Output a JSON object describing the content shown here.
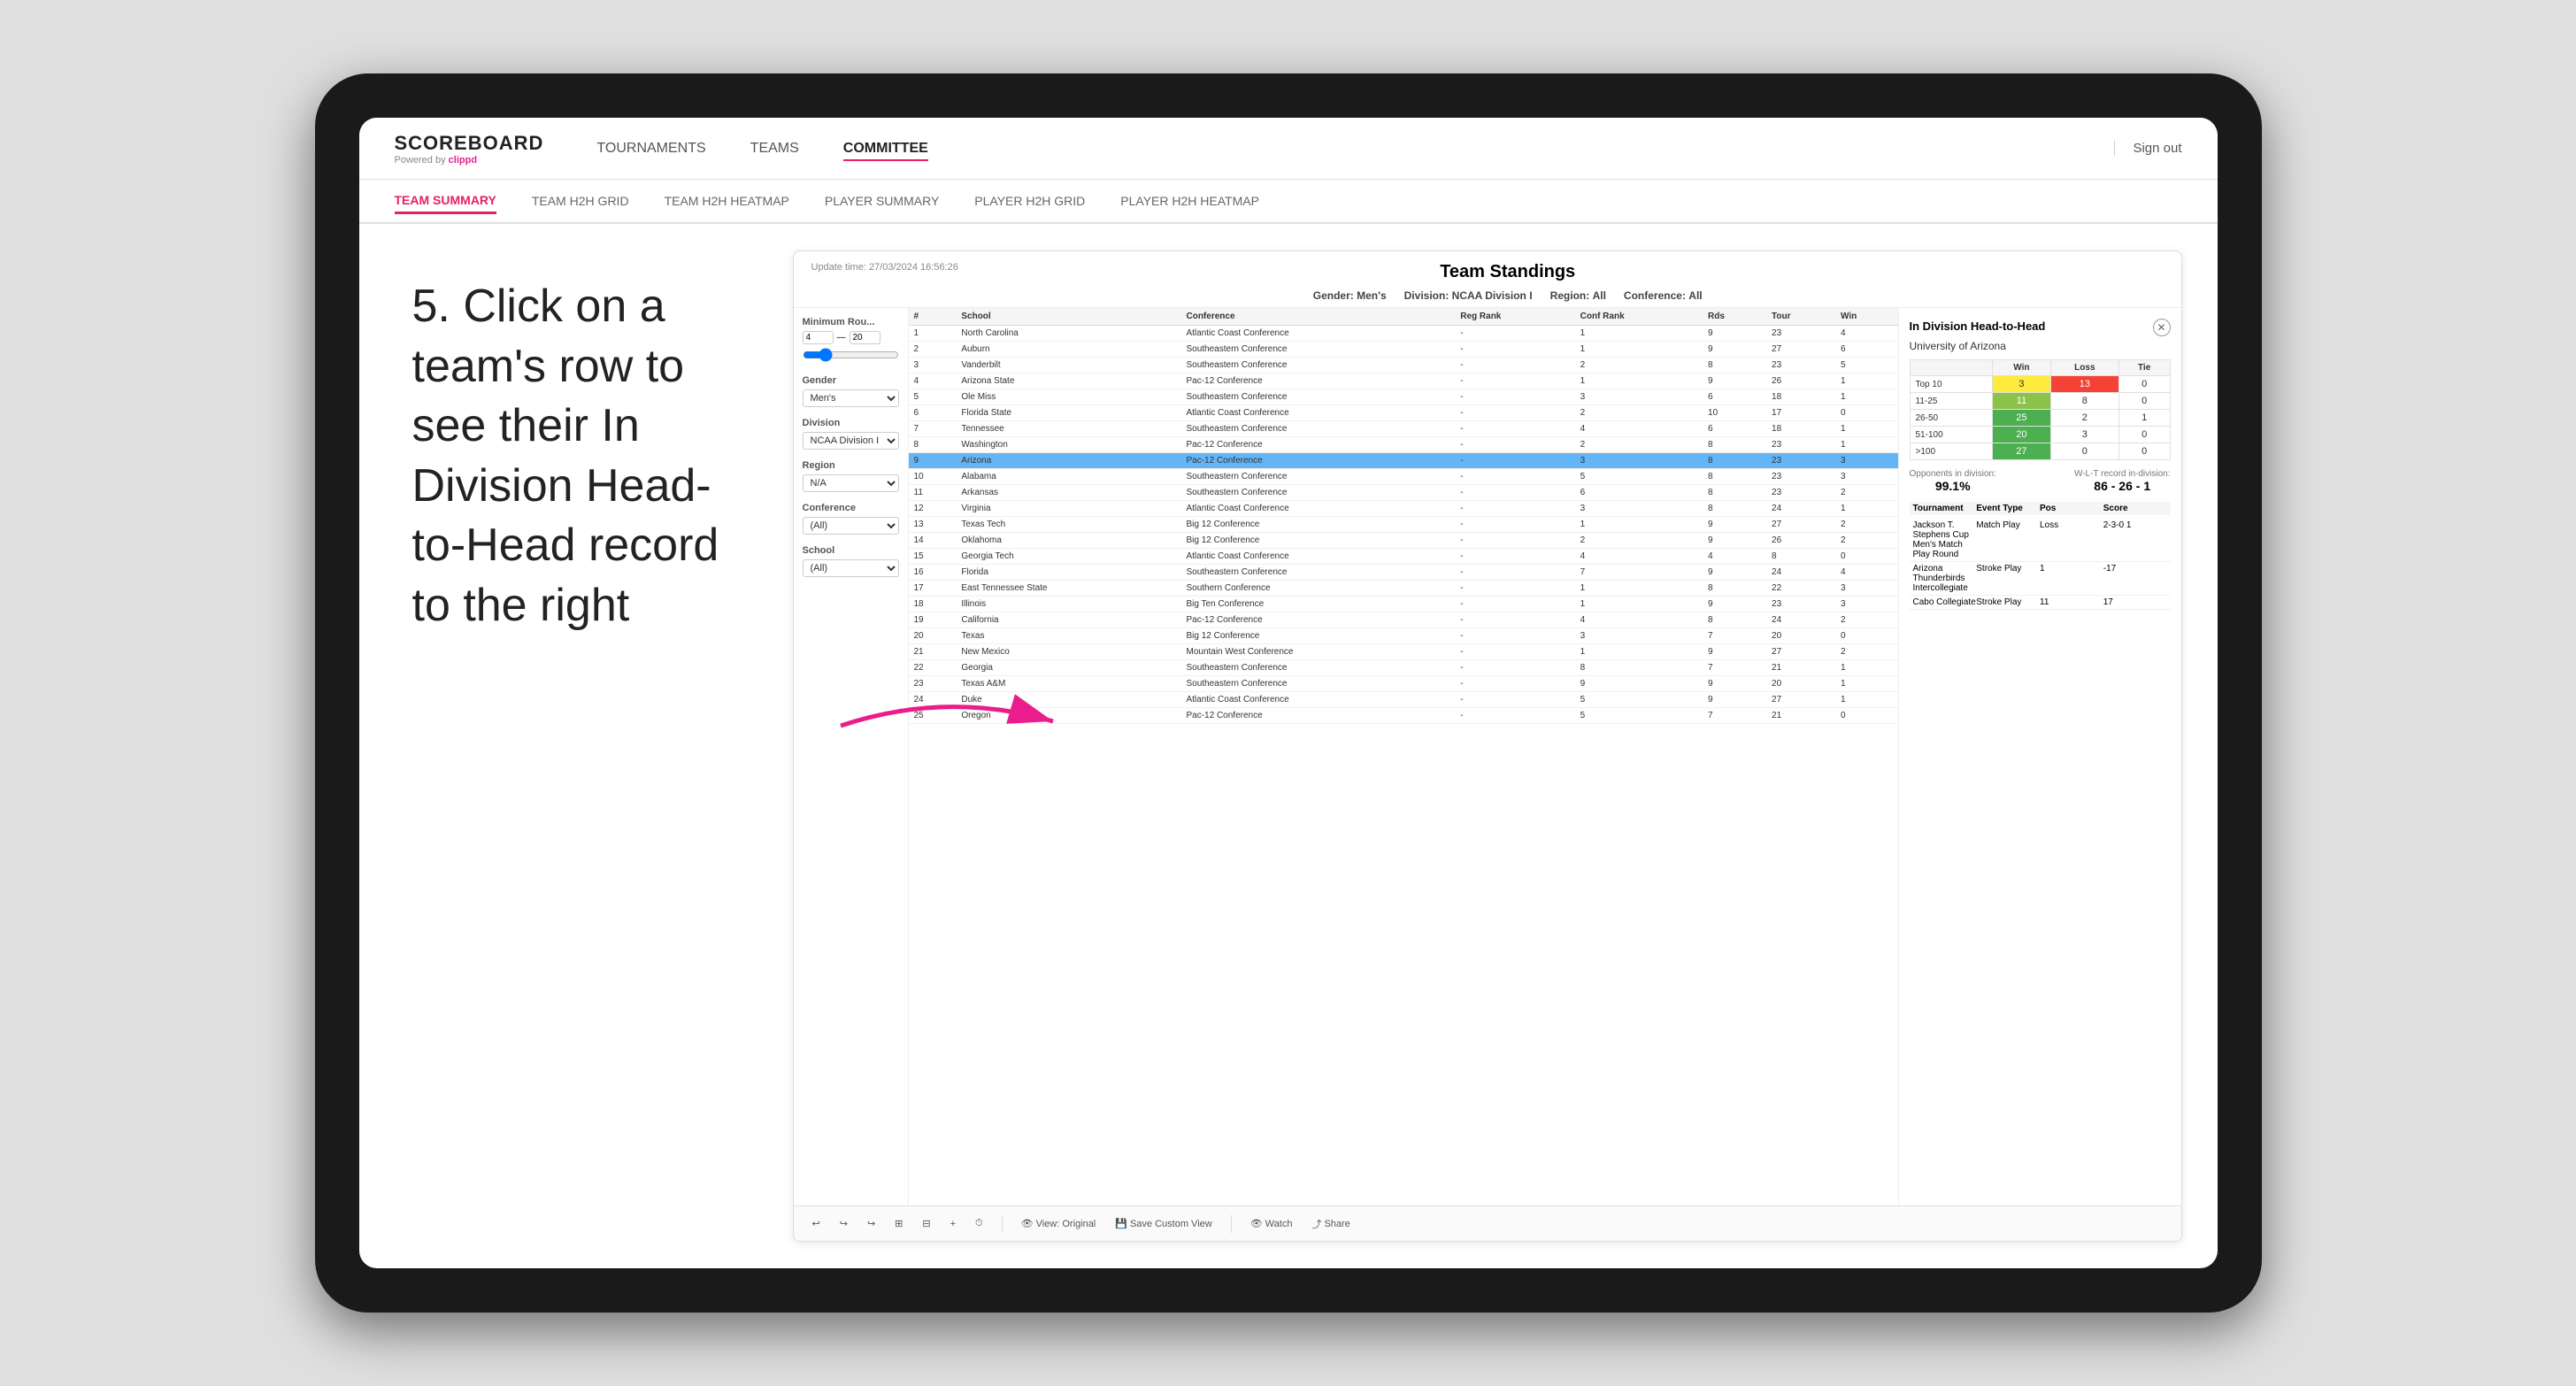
{
  "app": {
    "logo": "SCOREBOARD",
    "logo_sub": "Powered by ",
    "logo_brand": "clippd",
    "nav_links": [
      "TOURNAMENTS",
      "TEAMS",
      "COMMITTEE"
    ],
    "active_nav": "COMMITTEE",
    "sign_out": "Sign out",
    "sub_nav": [
      "TEAM SUMMARY",
      "TEAM H2H GRID",
      "TEAM H2H HEATMAP",
      "PLAYER SUMMARY",
      "PLAYER H2H GRID",
      "PLAYER H2H HEATMAP"
    ],
    "active_sub": "TEAM SUMMARY"
  },
  "instruction": {
    "text": "5. Click on a team's row to see their In Division Head-to-Head record to the right"
  },
  "standings": {
    "update_time_label": "Update time:",
    "update_time": "27/03/2024 16:56:26",
    "title": "Team Standings",
    "gender_label": "Gender:",
    "gender": "Men's",
    "division_label": "Division:",
    "division": "NCAA Division I",
    "region_label": "Region:",
    "region": "All",
    "conference_label": "Conference:",
    "conference": "All"
  },
  "filters": {
    "min_rounds_label": "Minimum Rou...",
    "min_rounds_value": "4",
    "min_rounds_max": "20",
    "gender_label": "Gender",
    "gender_value": "Men's",
    "division_label": "Division",
    "division_value": "NCAA Division I",
    "region_label": "Region",
    "region_value": "N/A",
    "conference_label": "Conference",
    "conference_value": "(All)",
    "school_label": "School",
    "school_value": "(All)"
  },
  "table": {
    "headers": [
      "#",
      "School",
      "Conference",
      "Reg Rank",
      "Conf Rank",
      "Rds",
      "Tour",
      "Win"
    ],
    "rows": [
      {
        "num": "1",
        "school": "North Carolina",
        "conference": "Atlantic Coast Conference",
        "reg_rank": "-",
        "conf_rank": "1",
        "rds": "9",
        "tour": "23",
        "win": "4"
      },
      {
        "num": "2",
        "school": "Auburn",
        "conference": "Southeastern Conference",
        "reg_rank": "-",
        "conf_rank": "1",
        "rds": "9",
        "tour": "27",
        "win": "6"
      },
      {
        "num": "3",
        "school": "Vanderbilt",
        "conference": "Southeastern Conference",
        "reg_rank": "-",
        "conf_rank": "2",
        "rds": "8",
        "tour": "23",
        "win": "5"
      },
      {
        "num": "4",
        "school": "Arizona State",
        "conference": "Pac-12 Conference",
        "reg_rank": "-",
        "conf_rank": "1",
        "rds": "9",
        "tour": "26",
        "win": "1"
      },
      {
        "num": "5",
        "school": "Ole Miss",
        "conference": "Southeastern Conference",
        "reg_rank": "-",
        "conf_rank": "3",
        "rds": "6",
        "tour": "18",
        "win": "1"
      },
      {
        "num": "6",
        "school": "Florida State",
        "conference": "Atlantic Coast Conference",
        "reg_rank": "-",
        "conf_rank": "2",
        "rds": "10",
        "tour": "17",
        "win": "0"
      },
      {
        "num": "7",
        "school": "Tennessee",
        "conference": "Southeastern Conference",
        "reg_rank": "-",
        "conf_rank": "4",
        "rds": "6",
        "tour": "18",
        "win": "1"
      },
      {
        "num": "8",
        "school": "Washington",
        "conference": "Pac-12 Conference",
        "reg_rank": "-",
        "conf_rank": "2",
        "rds": "8",
        "tour": "23",
        "win": "1"
      },
      {
        "num": "9",
        "school": "Arizona",
        "conference": "Pac-12 Conference",
        "reg_rank": "-",
        "conf_rank": "3",
        "rds": "8",
        "tour": "23",
        "win": "3",
        "selected": true
      },
      {
        "num": "10",
        "school": "Alabama",
        "conference": "Southeastern Conference",
        "reg_rank": "-",
        "conf_rank": "5",
        "rds": "8",
        "tour": "23",
        "win": "3"
      },
      {
        "num": "11",
        "school": "Arkansas",
        "conference": "Southeastern Conference",
        "reg_rank": "-",
        "conf_rank": "6",
        "rds": "8",
        "tour": "23",
        "win": "2"
      },
      {
        "num": "12",
        "school": "Virginia",
        "conference": "Atlantic Coast Conference",
        "reg_rank": "-",
        "conf_rank": "3",
        "rds": "8",
        "tour": "24",
        "win": "1"
      },
      {
        "num": "13",
        "school": "Texas Tech",
        "conference": "Big 12 Conference",
        "reg_rank": "-",
        "conf_rank": "1",
        "rds": "9",
        "tour": "27",
        "win": "2"
      },
      {
        "num": "14",
        "school": "Oklahoma",
        "conference": "Big 12 Conference",
        "reg_rank": "-",
        "conf_rank": "2",
        "rds": "9",
        "tour": "26",
        "win": "2"
      },
      {
        "num": "15",
        "school": "Georgia Tech",
        "conference": "Atlantic Coast Conference",
        "reg_rank": "-",
        "conf_rank": "4",
        "rds": "4",
        "tour": "8",
        "win": "0"
      },
      {
        "num": "16",
        "school": "Florida",
        "conference": "Southeastern Conference",
        "reg_rank": "-",
        "conf_rank": "7",
        "rds": "9",
        "tour": "24",
        "win": "4"
      },
      {
        "num": "17",
        "school": "East Tennessee State",
        "conference": "Southern Conference",
        "reg_rank": "-",
        "conf_rank": "1",
        "rds": "8",
        "tour": "22",
        "win": "3"
      },
      {
        "num": "18",
        "school": "Illinois",
        "conference": "Big Ten Conference",
        "reg_rank": "-",
        "conf_rank": "1",
        "rds": "9",
        "tour": "23",
        "win": "3"
      },
      {
        "num": "19",
        "school": "California",
        "conference": "Pac-12 Conference",
        "reg_rank": "-",
        "conf_rank": "4",
        "rds": "8",
        "tour": "24",
        "win": "2"
      },
      {
        "num": "20",
        "school": "Texas",
        "conference": "Big 12 Conference",
        "reg_rank": "-",
        "conf_rank": "3",
        "rds": "7",
        "tour": "20",
        "win": "0"
      },
      {
        "num": "21",
        "school": "New Mexico",
        "conference": "Mountain West Conference",
        "reg_rank": "-",
        "conf_rank": "1",
        "rds": "9",
        "tour": "27",
        "win": "2"
      },
      {
        "num": "22",
        "school": "Georgia",
        "conference": "Southeastern Conference",
        "reg_rank": "-",
        "conf_rank": "8",
        "rds": "7",
        "tour": "21",
        "win": "1"
      },
      {
        "num": "23",
        "school": "Texas A&M",
        "conference": "Southeastern Conference",
        "reg_rank": "-",
        "conf_rank": "9",
        "rds": "9",
        "tour": "20",
        "win": "1"
      },
      {
        "num": "24",
        "school": "Duke",
        "conference": "Atlantic Coast Conference",
        "reg_rank": "-",
        "conf_rank": "5",
        "rds": "9",
        "tour": "27",
        "win": "1"
      },
      {
        "num": "25",
        "school": "Oregon",
        "conference": "Pac-12 Conference",
        "reg_rank": "-",
        "conf_rank": "5",
        "rds": "7",
        "tour": "21",
        "win": "0"
      }
    ]
  },
  "h2h": {
    "title": "In Division Head-to-Head",
    "school": "University of Arizona",
    "win_label": "Win",
    "loss_label": "Loss",
    "tie_label": "Tie",
    "rows": [
      {
        "label": "Top 10",
        "win": "3",
        "loss": "13",
        "tie": "0",
        "win_class": "cell-yellow",
        "loss_class": "cell-red"
      },
      {
        "label": "11-25",
        "win": "11",
        "loss": "8",
        "tie": "0",
        "win_class": "cell-light-green",
        "loss_class": ""
      },
      {
        "label": "26-50",
        "win": "25",
        "loss": "2",
        "tie": "1",
        "win_class": "cell-green",
        "loss_class": ""
      },
      {
        "label": "51-100",
        "win": "20",
        "loss": "3",
        "tie": "0",
        "win_class": "cell-green",
        "loss_class": ""
      },
      {
        "label": ">100",
        "win": "27",
        "loss": "0",
        "tie": "0",
        "win_class": "cell-green",
        "loss_class": ""
      }
    ],
    "opponents_label": "Opponents in division:",
    "opponents_value": "99.1%",
    "wlt_label": "W-L-T record in-division:",
    "wlt_value": "86 - 26 - 1",
    "tournament_label": "Tournament",
    "event_type_label": "Event Type",
    "pos_label": "Pos",
    "score_label": "Score",
    "tournaments": [
      {
        "name": "Jackson T. Stephens Cup Men's Match Play Round",
        "event_type": "Match Play",
        "pos": "Loss",
        "score": "2-3-0 1"
      },
      {
        "name": "Arizona Thunderbirds Intercollegiate",
        "event_type": "Stroke Play",
        "pos": "1",
        "score": "-17"
      },
      {
        "name": "Cabo Collegiate",
        "event_type": "Stroke Play",
        "pos": "11",
        "score": "17"
      }
    ]
  },
  "toolbar": {
    "undo": "↩",
    "redo_1": "↪",
    "redo_2": "↪",
    "copy": "⊞",
    "paste": "⊟",
    "clock": "⏱",
    "view_original": "View: Original",
    "save_custom": "Save Custom View",
    "watch": "Watch",
    "share": "Share"
  }
}
